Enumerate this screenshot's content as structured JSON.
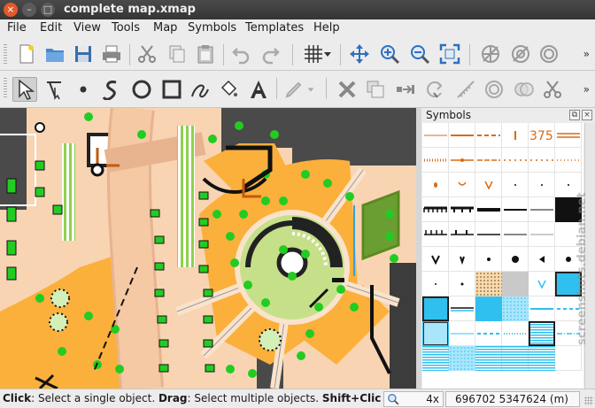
{
  "window": {
    "title": "complete map.xmap",
    "close_glyph": "×",
    "min_glyph": "–",
    "max_glyph": "□"
  },
  "menu": [
    {
      "label": "File",
      "name": "menu-file"
    },
    {
      "label": "Edit",
      "name": "menu-edit"
    },
    {
      "label": "View",
      "name": "menu-view"
    },
    {
      "label": "Tools",
      "name": "menu-tools"
    },
    {
      "label": "Map",
      "name": "menu-map"
    },
    {
      "label": "Symbols",
      "name": "menu-symbols"
    },
    {
      "label": "Templates",
      "name": "menu-templates"
    },
    {
      "label": "Help",
      "name": "menu-help"
    }
  ],
  "toolbar_main": [
    "new-file-icon",
    "open-folder-icon",
    "save-disk-icon",
    "print-icon",
    "cut-icon",
    "copy-icon",
    "paste-icon",
    "undo-icon",
    "redo-icon",
    "grid-icon",
    "pan-move-icon",
    "zoom-in-icon",
    "zoom-out-icon",
    "fullscreen-icon",
    "template-hide-icon",
    "template-hide-all-icon",
    "template-show-icon"
  ],
  "toolbar_draw": [
    "edit-objects-icon",
    "edit-line-icon",
    "draw-point-icon",
    "draw-path-icon",
    "draw-circle-icon",
    "draw-rectangle-icon",
    "draw-freehand-icon",
    "fill-bucket-icon",
    "draw-text-icon",
    "pen-icon",
    "delete-icon",
    "duplicate-icon",
    "switch-symbol-icon",
    "rotate-icon",
    "measure-icon",
    "union-icon",
    "intersect-icon",
    "cut-tool-icon"
  ],
  "symbols_panel": {
    "title": "Symbols",
    "float_glyph": "⧉",
    "close_glyph": "×",
    "watermark": "screenshots.debian.net"
  },
  "symbol_cells": [
    [
      "line-orange-thin",
      "line-orange",
      "line-orange-dashed",
      "tick-orange",
      "text-375",
      "line-orange-double"
    ],
    [
      "line-orange-dotted",
      "line-orange-dot",
      "line-orange-dots",
      "line-orange-sparse",
      "line-orange-sparse",
      "line-orange-x"
    ],
    [
      "dot-orange",
      "cup-orange",
      "v-orange",
      "dot-small",
      "dot-small",
      "dot-small"
    ],
    [
      "line-black-teeth",
      "line-black-teeth2",
      "line-black-thick",
      "line-black",
      "line-black-thin",
      "area-black"
    ],
    [
      "line-black-ticks",
      "line-black-ticks2",
      "line-black-med",
      "line-black-thin",
      "line-gray-thin",
      "empty"
    ],
    [
      "v-black",
      "v-black-small",
      "dot-black",
      "dot-black-large",
      "triangle-black",
      "dot-black-med"
    ],
    [
      "dot-small",
      "dot-tiny",
      "area-orange-dots",
      "area-gray",
      "v-blue",
      "area-blue-framed"
    ],
    [
      "area-blue-framed",
      "line-black-blue",
      "area-blue",
      "area-blue-dots",
      "line-blue",
      "line-blue-dashed"
    ],
    [
      "area-blue-light-framed",
      "line-blue-thin",
      "line-blue-dashed",
      "line-blue-dotted",
      "area-blue-lines-framed",
      "line-blue-x"
    ],
    [
      "area-blue-lines",
      "area-blue-dots",
      "area-blue-lines",
      "area-blue-lines",
      "area-blue-lines",
      "empty"
    ]
  ],
  "status": {
    "line_prefix_click": "Click",
    "line_text_1": ": Select a single object. ",
    "line_prefix_drag": "Drag",
    "line_text_2": ": Select multiple objects. ",
    "line_prefix_shift": "Shift+Click",
    "zoom": "4x",
    "coordinates": "696702 5347624 (m)"
  }
}
